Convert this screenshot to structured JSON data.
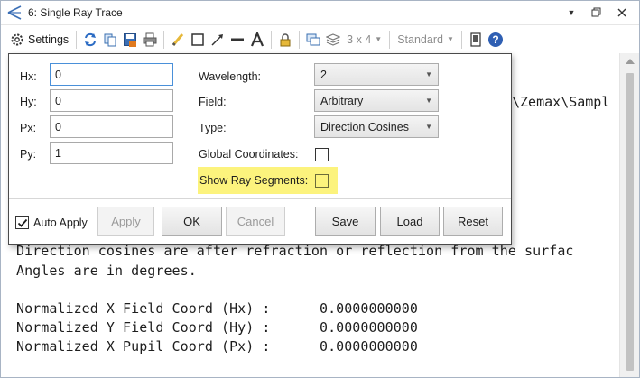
{
  "window": {
    "title": "6: Single Ray Trace"
  },
  "toolbar": {
    "settings_label": "Settings",
    "layout_label": "3 x 4",
    "style_label": "Standard",
    "icons": [
      "settings-gear-icon",
      "refresh-icon",
      "copy-icon",
      "save-icon",
      "print-icon",
      "pencil-icon",
      "rectangle-icon",
      "arrow-icon",
      "line-icon",
      "text-icon",
      "lock-icon",
      "windows-icon",
      "layers-icon",
      "export-icon",
      "help-icon"
    ]
  },
  "panel": {
    "hx_label": "Hx:",
    "hx_value": "0",
    "hy_label": "Hy:",
    "hy_value": "0",
    "px_label": "Px:",
    "px_value": "0",
    "py_label": "Py:",
    "py_value": "1",
    "wavelength_label": "Wavelength:",
    "wavelength_value": "2",
    "field_label": "Field:",
    "field_value": "Arbitrary",
    "type_label": "Type:",
    "type_value": "Direction Cosines",
    "global_coords_label": "Global Coordinates:",
    "global_coords_checked": false,
    "show_ray_segments_label": "Show Ray Segments:",
    "show_ray_segments_checked": false,
    "auto_apply_label": "Auto Apply",
    "auto_apply_checked": true,
    "apply_label": "Apply",
    "ok_label": "OK",
    "cancel_label": "Cancel",
    "save_label": "Save",
    "load_label": "Load",
    "reset_label": "Reset",
    "highlight_color": "#fcf37d"
  },
  "output": {
    "path_fragment": "\\Zemax\\Sampl",
    "lines": [
      "Direction cosines are after refraction or reflection from the surfac",
      "Angles are in degrees.",
      "",
      "Normalized X Field Coord (Hx) :      0.0000000000",
      "Normalized Y Field Coord (Hy) :      0.0000000000",
      "Normalized X Pupil Coord (Px) :      0.0000000000"
    ]
  }
}
